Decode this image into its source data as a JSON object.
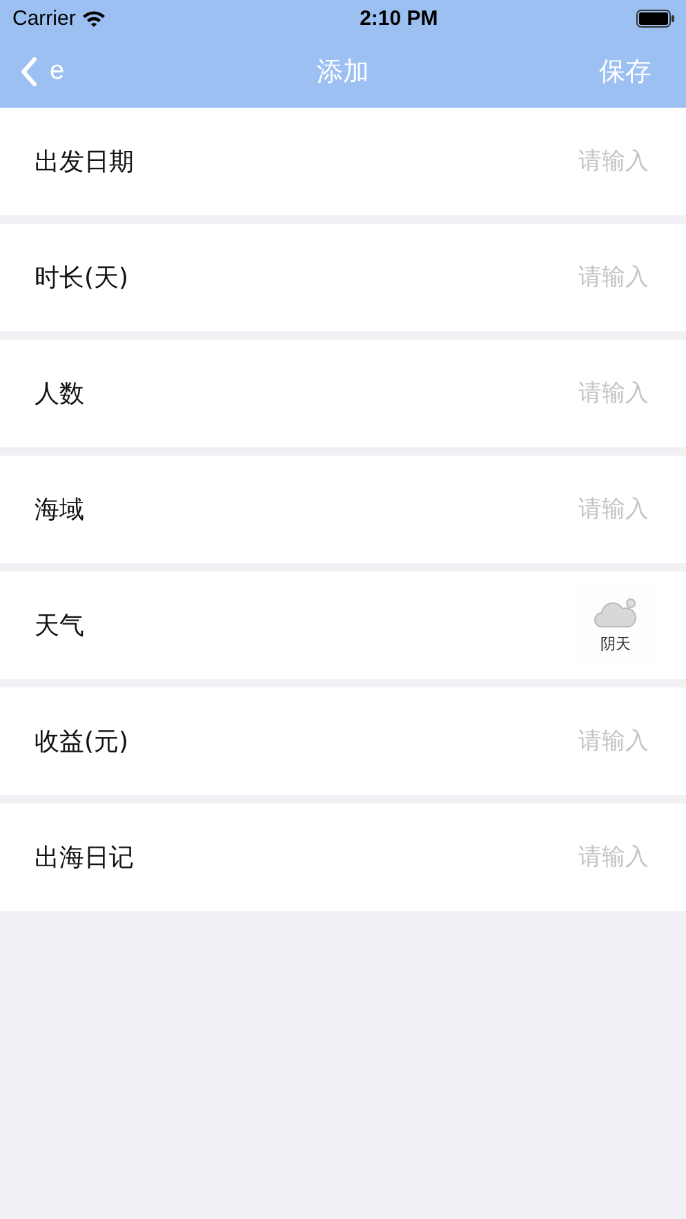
{
  "status_bar": {
    "carrier": "Carrier",
    "time": "2:10 PM"
  },
  "nav": {
    "back_label": "e",
    "title": "添加",
    "action": "保存"
  },
  "rows": [
    {
      "kind": "input",
      "label": "出发日期",
      "placeholder": "请输入"
    },
    {
      "kind": "input",
      "label": "时长(天)",
      "placeholder": "请输入"
    },
    {
      "kind": "input",
      "label": "人数",
      "placeholder": "请输入"
    },
    {
      "kind": "input",
      "label": "海域",
      "placeholder": "请输入"
    },
    {
      "kind": "weather",
      "label": "天气",
      "weather": "阴天"
    },
    {
      "kind": "input",
      "label": "收益(元)",
      "placeholder": "请输入"
    },
    {
      "kind": "input",
      "label": "出海日记",
      "placeholder": "请输入"
    }
  ]
}
